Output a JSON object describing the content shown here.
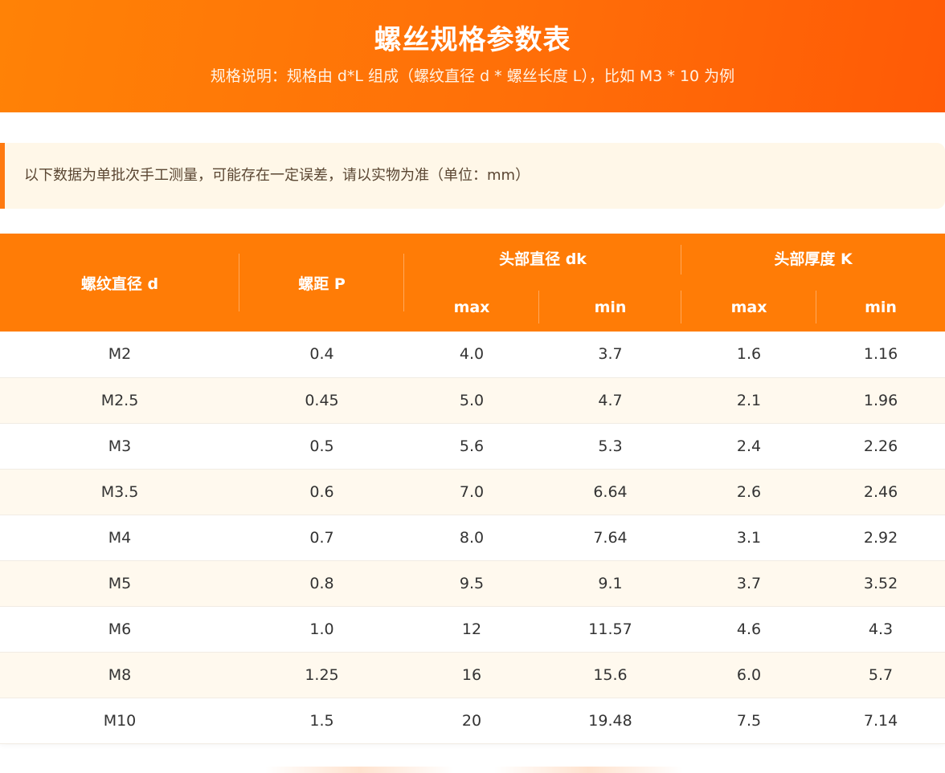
{
  "header": {
    "title": "螺丝规格参数表",
    "subtitle": "规格说明：规格由 d*L 组成（螺纹直径 d * 螺丝长度 L），比如 M3 * 10 为例"
  },
  "notice": {
    "text": "以下数据为单批次手工测量，可能存在一定误差，请以实物为准（单位：mm）"
  },
  "table": {
    "headers": {
      "thread_diameter": "螺纹直径 d",
      "pitch": "螺距 P",
      "head_diameter": "头部直径 dk",
      "head_thickness": "头部厚度 K",
      "max": "max",
      "min": "min"
    },
    "rows": [
      [
        "M2",
        "0.4",
        "4.0",
        "3.7",
        "1.6",
        "1.16"
      ],
      [
        "M2.5",
        "0.45",
        "5.0",
        "4.7",
        "2.1",
        "1.96"
      ],
      [
        "M3",
        "0.5",
        "5.6",
        "5.3",
        "2.4",
        "2.26"
      ],
      [
        "M3.5",
        "0.6",
        "7.0",
        "6.64",
        "2.6",
        "2.46"
      ],
      [
        "M4",
        "0.7",
        "8.0",
        "7.64",
        "3.1",
        "2.92"
      ],
      [
        "M5",
        "0.8",
        "9.5",
        "9.1",
        "3.7",
        "3.52"
      ],
      [
        "M6",
        "1.0",
        "12",
        "11.57",
        "4.6",
        "4.3"
      ],
      [
        "M8",
        "1.25",
        "16",
        "15.6",
        "6.0",
        "5.7"
      ],
      [
        "M10",
        "1.5",
        "20",
        "19.48",
        "7.5",
        "7.14"
      ]
    ]
  },
  "colors": {
    "accent": "#ff7c06",
    "header_gradient_end": "#ff5a06",
    "notice_bg": "#fff7e8",
    "row_alt_bg": "#fff9ee"
  }
}
